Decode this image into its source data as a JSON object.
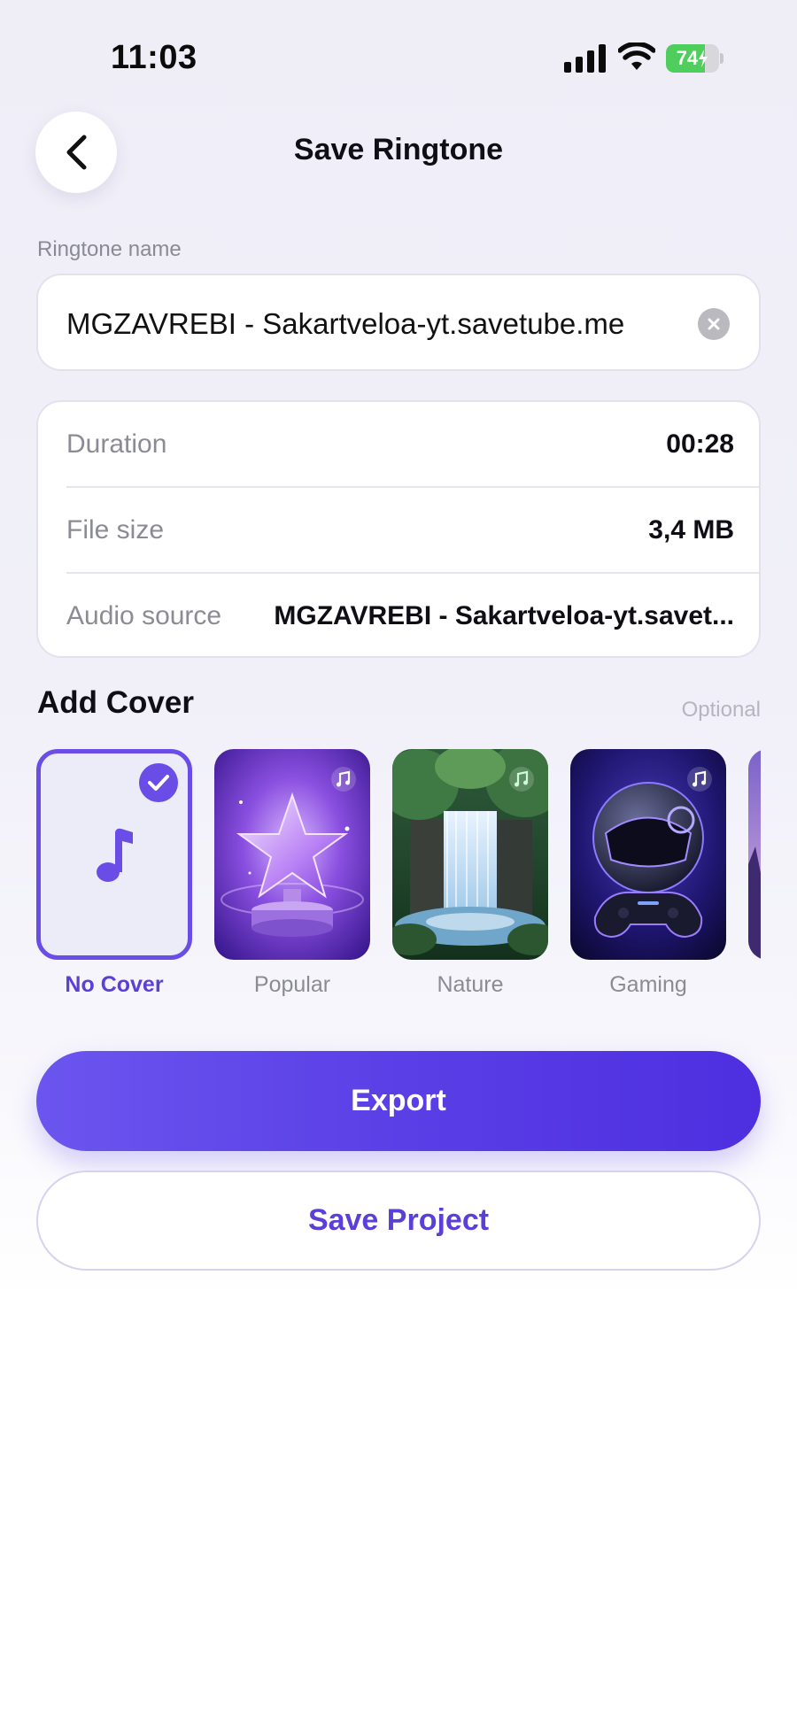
{
  "status_bar": {
    "time": "11:03",
    "battery": "74",
    "battery_level": 0.74,
    "icons": [
      "signal-icon",
      "wifi-icon",
      "battery-icon"
    ]
  },
  "header": {
    "title": "Save Ringtone",
    "back_icon": "chevron-left-icon"
  },
  "name_field": {
    "label": "Ringtone name",
    "value": "MGZAVREBI - Sakartveloa-yt.savetube.me",
    "clear_icon": "clear-icon"
  },
  "info": {
    "duration_label": "Duration",
    "duration_value": "00:28",
    "size_label": "File size",
    "size_value": "3,4 MB",
    "source_label": "Audio source",
    "source_value": "MGZAVREBI - Sakartveloa-yt.savet..."
  },
  "cover": {
    "title": "Add Cover",
    "optional": "Optional",
    "items": [
      {
        "label": "No Cover",
        "selected": true,
        "icon": "music-note-icon"
      },
      {
        "label": "Popular",
        "selected": false,
        "icon": "music-note-icon"
      },
      {
        "label": "Nature",
        "selected": false,
        "icon": "music-note-icon"
      },
      {
        "label": "Gaming",
        "selected": false,
        "icon": "music-note-icon"
      }
    ]
  },
  "actions": {
    "export_label": "Export",
    "save_label": "Save Project"
  },
  "colors": {
    "accent": "#5a3fd8",
    "accent_gradient_start": "#6b55ef",
    "accent_gradient_end": "#4e2fe0",
    "battery_green": "#4fce5d"
  }
}
